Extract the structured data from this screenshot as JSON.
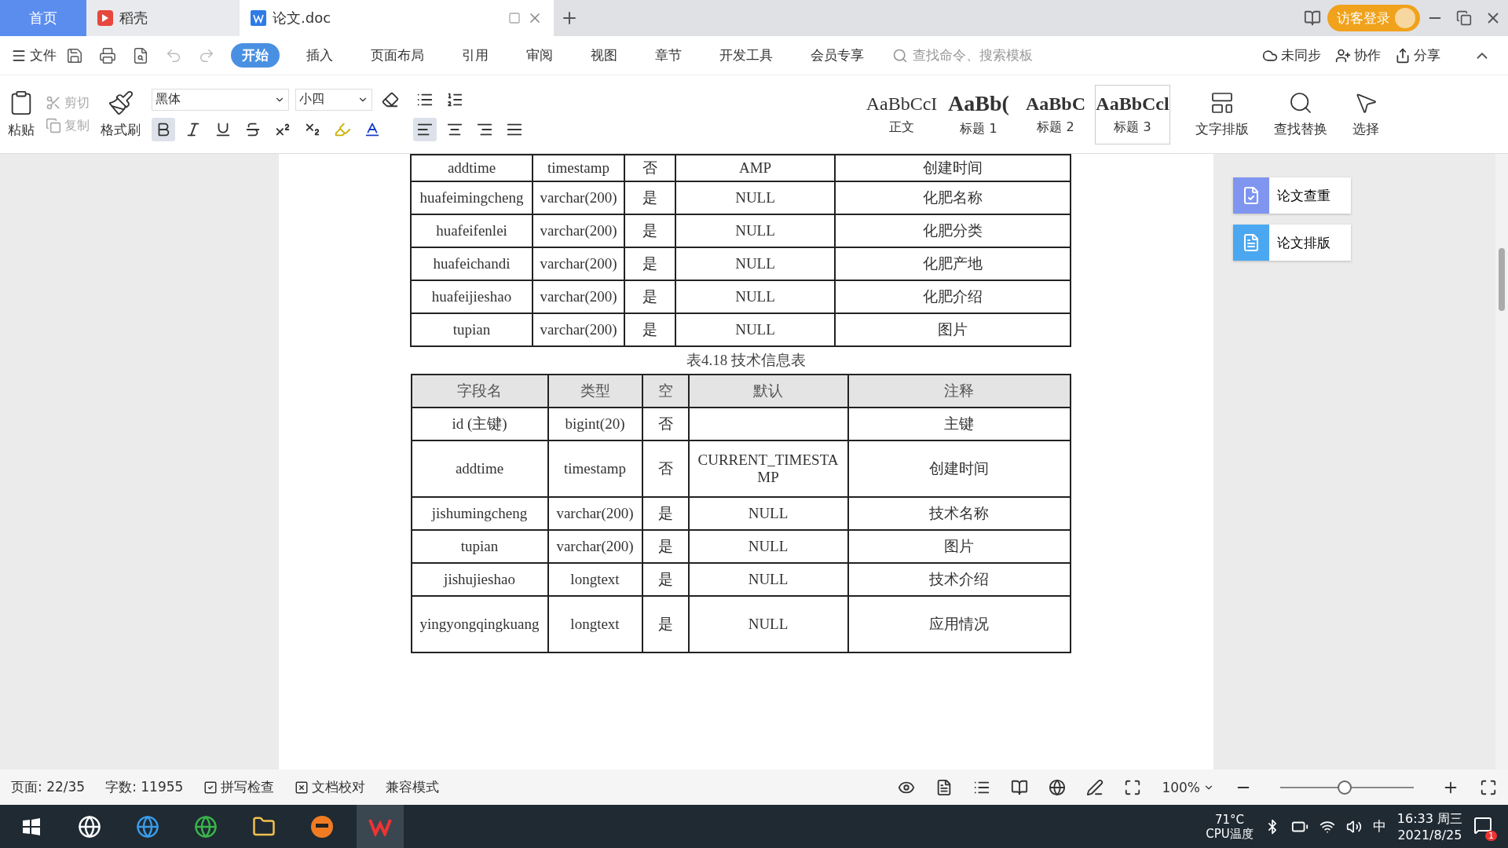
{
  "tabs": [
    {
      "label": "首页",
      "kind": "home",
      "selected": false
    },
    {
      "label": "稻壳",
      "kind": "docer",
      "selected": false
    },
    {
      "label": "论文.doc",
      "kind": "doc",
      "selected": true
    }
  ],
  "login": "访客登录",
  "menu": {
    "file": "文件",
    "tabs": [
      {
        "label": "开始",
        "selected": true
      },
      {
        "label": "插入",
        "selected": false
      },
      {
        "label": "页面布局",
        "selected": false
      },
      {
        "label": "引用",
        "selected": false
      },
      {
        "label": "审阅",
        "selected": false
      },
      {
        "label": "视图",
        "selected": false
      },
      {
        "label": "章节",
        "selected": false
      },
      {
        "label": "开发工具",
        "selected": false
      },
      {
        "label": "会员专享",
        "selected": false
      }
    ],
    "search": {
      "placeholder": "查找命令、搜索模板"
    },
    "actions": [
      "未同步",
      "协作",
      "分享"
    ]
  },
  "toolbar": {
    "paste": "粘贴",
    "cut": "剪切",
    "copy": "复制",
    "painter": "格式刷",
    "font": "黑体",
    "size": "小四",
    "bold": true,
    "align_left": true,
    "styles": [
      {
        "preview": "AaBbCcI",
        "name": "正文",
        "selected": false
      },
      {
        "preview": "AaBb(",
        "name": "标题 1",
        "selected": false
      },
      {
        "preview": "AaBbC",
        "name": "标题 2",
        "selected": false
      },
      {
        "preview": "AaBbCcl",
        "name": "标题 3",
        "selected": true
      }
    ],
    "big": [
      "文字排版",
      "查找替换",
      "选择"
    ]
  },
  "document": {
    "table1_rows": [
      [
        "addtime",
        "timestamp",
        "否",
        "AMP",
        "创建时间"
      ],
      [
        "huafeimingcheng",
        "varchar(200)",
        "是",
        "NULL",
        "化肥名称"
      ],
      [
        "huafeifenlei",
        "varchar(200)",
        "是",
        "NULL",
        "化肥分类"
      ],
      [
        "huafeichandi",
        "varchar(200)",
        "是",
        "NULL",
        "化肥产地"
      ],
      [
        "huafeijieshao",
        "varchar(200)",
        "是",
        "NULL",
        "化肥介绍"
      ],
      [
        "tupian",
        "varchar(200)",
        "是",
        "NULL",
        "图片"
      ]
    ],
    "caption": "表4.18 技术信息表",
    "table2_columns": [
      "字段名",
      "类型",
      "空",
      "默认",
      "注释"
    ],
    "table2_rows": [
      [
        "id (主键)",
        "bigint(20)",
        "否",
        "",
        "主键"
      ],
      [
        "addtime",
        "timestamp",
        "否",
        "CURRENT_TIMESTAMP",
        "创建时间"
      ],
      [
        "jishumingcheng",
        "varchar(200)",
        "是",
        "NULL",
        "技术名称"
      ],
      [
        "tupian",
        "varchar(200)",
        "是",
        "NULL",
        "图片"
      ],
      [
        "jishujieshao",
        "longtext",
        "是",
        "NULL",
        "技术介绍"
      ],
      [
        "yingyongqingkuang",
        "longtext",
        "是",
        "NULL",
        "应用情况"
      ]
    ]
  },
  "side_panel": [
    "论文查重",
    "论文排版"
  ],
  "status_bar": {
    "page": "页面: 22/35",
    "words": "字数: 11955",
    "items": [
      "拼写检查",
      "文档校对"
    ],
    "mode": "兼容模式",
    "zoom": "100%",
    "level": 0.48
  },
  "taskbar": {
    "temp": "71°C",
    "temp_label": "CPU温度",
    "ime": "中",
    "time": "16:33 周三",
    "date": "2021/8/25",
    "badge": "1"
  }
}
